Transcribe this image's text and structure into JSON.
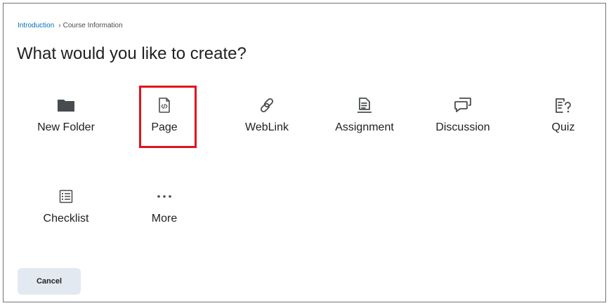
{
  "breadcrumb": {
    "link": "Introduction",
    "separator": "›",
    "current": "Course Information"
  },
  "title": "What would you like to create?",
  "options": [
    {
      "label": "New Folder",
      "icon": "folder-icon"
    },
    {
      "label": "Page",
      "icon": "page-code-icon"
    },
    {
      "label": "WebLink",
      "icon": "link-icon"
    },
    {
      "label": "Assignment",
      "icon": "assignment-icon"
    },
    {
      "label": "Discussion",
      "icon": "discussion-icon"
    },
    {
      "label": "Quiz",
      "icon": "quiz-icon"
    },
    {
      "label": "Checklist",
      "icon": "checklist-icon"
    },
    {
      "label": "More",
      "icon": "more-dots-icon"
    }
  ],
  "cancel_label": "Cancel",
  "colors": {
    "link": "#006fbf",
    "text": "#202122",
    "icon": "#494c4e",
    "highlight": "#e0141e",
    "cancel_bg": "#e3e9f1"
  }
}
